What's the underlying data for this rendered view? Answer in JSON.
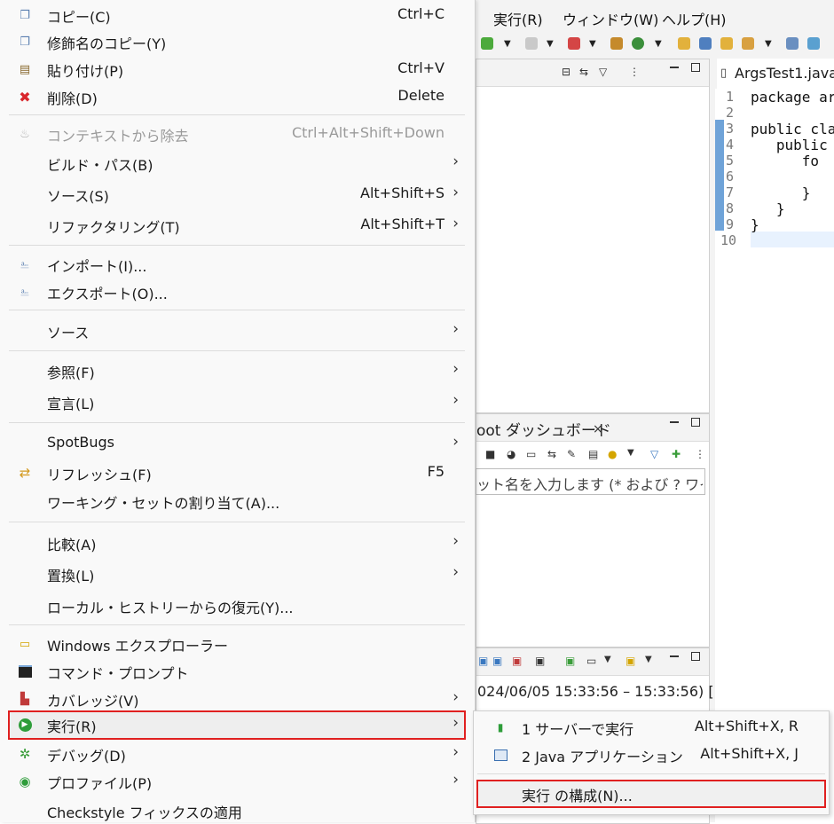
{
  "ide": {
    "menubar": [
      "実行(R)",
      "ウィンドウ(W)",
      "ヘルプ(H)"
    ],
    "boot_dashboard_tab": "oot ダッシュボード",
    "boot_dashboard_close": "×",
    "filter_placeholder": "ット名を入力します (* および ? ワイル",
    "console_text": "024/06/05 15:33:56 – 15:33:56) [",
    "editor_tab": "ArgsTest1.java",
    "line_numbers": [
      "1",
      "2",
      "3",
      "4",
      "5",
      "6",
      "7",
      "8",
      "9",
      "10"
    ],
    "code_lines": [
      "package ar",
      "",
      "public cla",
      "   public",
      "      fo",
      "",
      "      }",
      "   }",
      "}",
      ""
    ]
  },
  "menu": {
    "items": [
      {
        "icon": "copy-icon",
        "label": "コピー(C)",
        "shortcut": "Ctrl+C"
      },
      {
        "icon": "copy-qualified-name-icon",
        "label": "修飾名のコピー(Y)"
      },
      {
        "icon": "paste-icon",
        "label": "貼り付け(P)",
        "shortcut": "Ctrl+V"
      },
      {
        "icon": "delete-icon",
        "label": "削除(D)",
        "shortcut": "Delete"
      },
      {
        "icon": "remove-context-icon",
        "label": "コンテキストから除去",
        "shortcut": "Ctrl+Alt+Shift+Down",
        "disabled": true
      },
      {
        "label": "ビルド・パス(B)",
        "submenu": true
      },
      {
        "label": "ソース(S)",
        "shortcut": "Alt+Shift+S",
        "submenu": true
      },
      {
        "label": "リファクタリング(T)",
        "shortcut": "Alt+Shift+T",
        "submenu": true
      },
      {
        "icon": "import-icon",
        "label": "インポート(I)..."
      },
      {
        "icon": "export-icon",
        "label": "エクスポート(O)..."
      },
      {
        "label": "ソース",
        "submenu": true
      },
      {
        "label": "参照(F)",
        "submenu": true
      },
      {
        "label": "宣言(L)",
        "submenu": true
      },
      {
        "label": "SpotBugs",
        "submenu": true
      },
      {
        "icon": "refresh-icon",
        "label": "リフレッシュ(F)",
        "shortcut": "F5"
      },
      {
        "label": "ワーキング・セットの割り当て(A)..."
      },
      {
        "label": "比較(A)",
        "submenu": true
      },
      {
        "label": "置換(L)",
        "submenu": true
      },
      {
        "label": "ローカル・ヒストリーからの復元(Y)..."
      },
      {
        "icon": "windows-explorer-icon",
        "label": "Windows エクスプローラー"
      },
      {
        "icon": "command-prompt-icon",
        "label": "コマンド・プロンプト"
      },
      {
        "icon": "coverage-icon",
        "label": "カバレッジ(V)",
        "submenu": true
      },
      {
        "icon": "run-icon",
        "label": "実行(R)",
        "submenu": true,
        "selected": true
      },
      {
        "icon": "debug-icon",
        "label": "デバッグ(D)",
        "submenu": true
      },
      {
        "icon": "profile-icon",
        "label": "プロファイル(P)",
        "submenu": true
      },
      {
        "label": "Checkstyle フィックスの適用"
      }
    ],
    "arrow": "›"
  },
  "submenu": {
    "items": [
      {
        "icon": "run-on-server-icon",
        "label": "1 サーバーで実行",
        "shortcut": "Alt+Shift+X, R"
      },
      {
        "icon": "java-application-icon",
        "label": "2 Java アプリケーション",
        "shortcut": "Alt+Shift+X, J"
      },
      {
        "label": "実行 の構成(N)...",
        "highlighted": true
      }
    ]
  },
  "colors": {
    "highlight_border": "#e02020",
    "run_green": "#2e9d3a",
    "delete_red": "#d9262c",
    "gutter_blue": "#6fa3d8"
  }
}
